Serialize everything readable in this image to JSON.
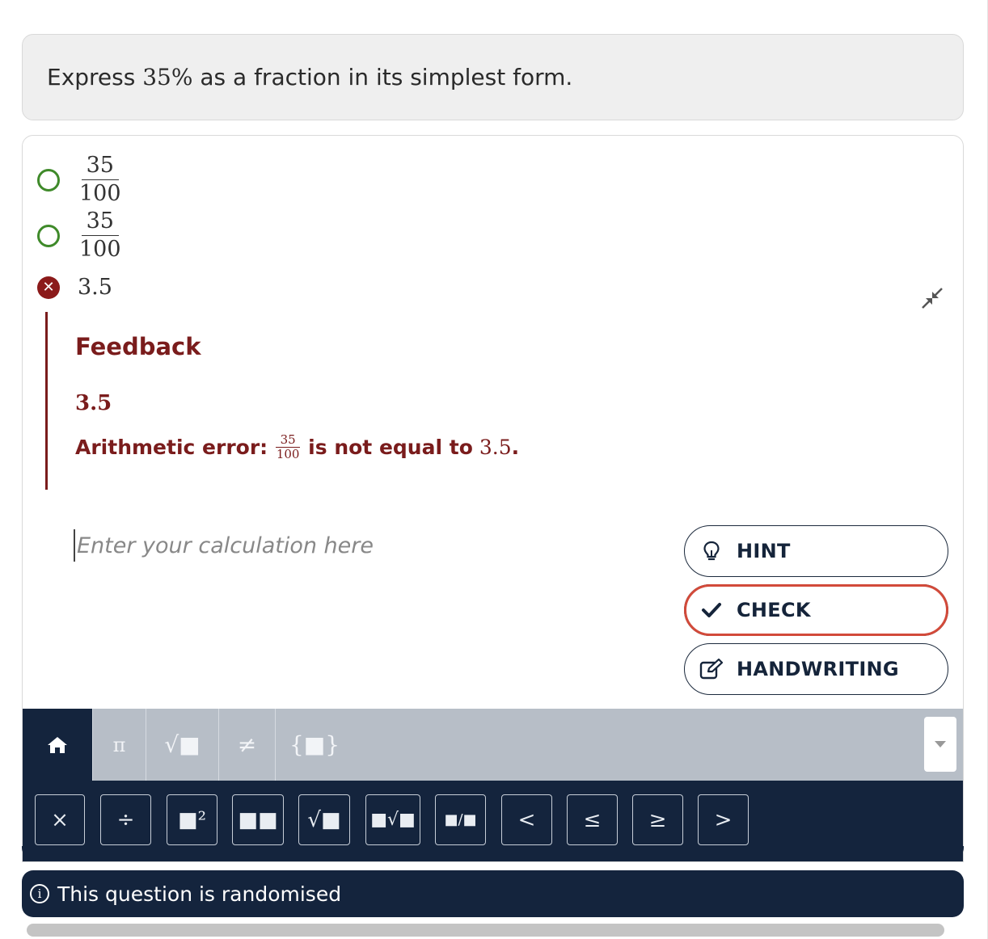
{
  "question": {
    "prefix": "Express ",
    "math": "35%",
    "suffix": " as a fraction in its simplest form."
  },
  "options": [
    {
      "numerator": "35",
      "denominator": "100",
      "state": "unselected"
    },
    {
      "numerator": "35",
      "denominator": "100",
      "state": "unselected"
    },
    {
      "text": "3.5",
      "state": "incorrect"
    }
  ],
  "feedback": {
    "title": "Feedback",
    "value": "3.5",
    "message_prefix": "Arithmetic error:",
    "frac_numerator": "35",
    "frac_denominator": "100",
    "message_middle": "is not equal to",
    "message_value": "3.5",
    "message_end": "."
  },
  "calc_input": {
    "placeholder": "Enter your calculation here",
    "value": ""
  },
  "buttons": {
    "hint": "HINT",
    "check": "CHECK",
    "handwriting": "HANDWRITING"
  },
  "keyboard": {
    "tabs": [
      "home",
      "π",
      "√■",
      "≠",
      "{■}"
    ],
    "active_tab": "home",
    "keys": [
      "×",
      "÷",
      "■²",
      "■■",
      "√■",
      "■√■",
      "■/■",
      "<",
      "≤",
      "≥",
      ">"
    ]
  },
  "info": {
    "text": "This question is randomised"
  },
  "colors": {
    "navy": "#14243d",
    "feedback_red": "#7a1c1c",
    "radio_green": "#3f8a2a",
    "check_outline": "#d24a3a",
    "tab_grey": "#b7bec7"
  }
}
